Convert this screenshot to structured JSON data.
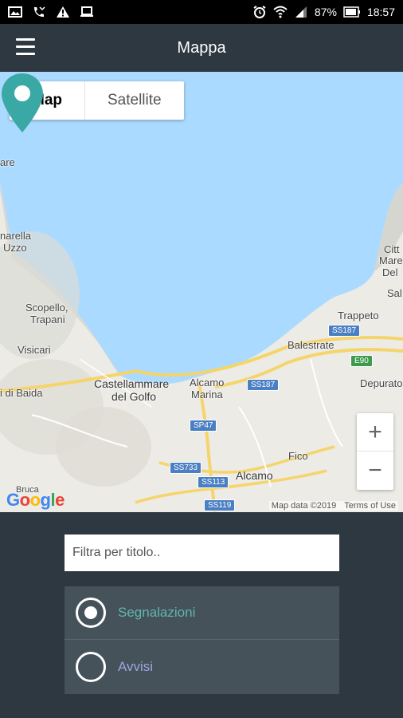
{
  "status_bar": {
    "battery": "87%",
    "time": "18:57"
  },
  "app_bar": {
    "title": "Mappa"
  },
  "map": {
    "map_type_control": {
      "map_label": "Map",
      "satellite_label": "Satellite",
      "selected": "Map"
    },
    "labels": {
      "are": "are",
      "marella": "narella",
      "uzzo": "Uzzo",
      "scopello": "Scopello,",
      "trapani": "Trapani",
      "visicari": "Visicari",
      "baida": "i di Baida",
      "castellammare1": "Castellammare",
      "castellammare2": "del Golfo",
      "alcamo_marina1": "Alcamo",
      "alcamo_marina2": "Marina",
      "balestrate": "Balestrate",
      "trappeto": "Trappeto",
      "citta": "Citt",
      "mare": "Mare",
      "del": "Del",
      "sal": "Sal",
      "depurato": "Depurato",
      "fico": "Fico",
      "alcamo": "Alcamo",
      "bruca": "Bruca"
    },
    "road_shields": {
      "ss187_a": "SS187",
      "ss187_b": "SS187",
      "e90": "E90",
      "sp47": "SP47",
      "ss733": "SS733",
      "ss113": "SS113",
      "ss119": "SS119"
    },
    "zoom_in": "+",
    "zoom_out": "−",
    "google_logo": "Google",
    "map_data": "Map data ©2019",
    "terms": "Terms of Use",
    "marker_color": "#3aa9a5"
  },
  "filter": {
    "placeholder": "Filtra per titolo..",
    "value": ""
  },
  "options": [
    {
      "label": "Segnalazioni",
      "selected": true,
      "color": "#5fb6b0"
    },
    {
      "label": "Avvisi",
      "selected": false,
      "color": "#9aa7e0"
    }
  ]
}
